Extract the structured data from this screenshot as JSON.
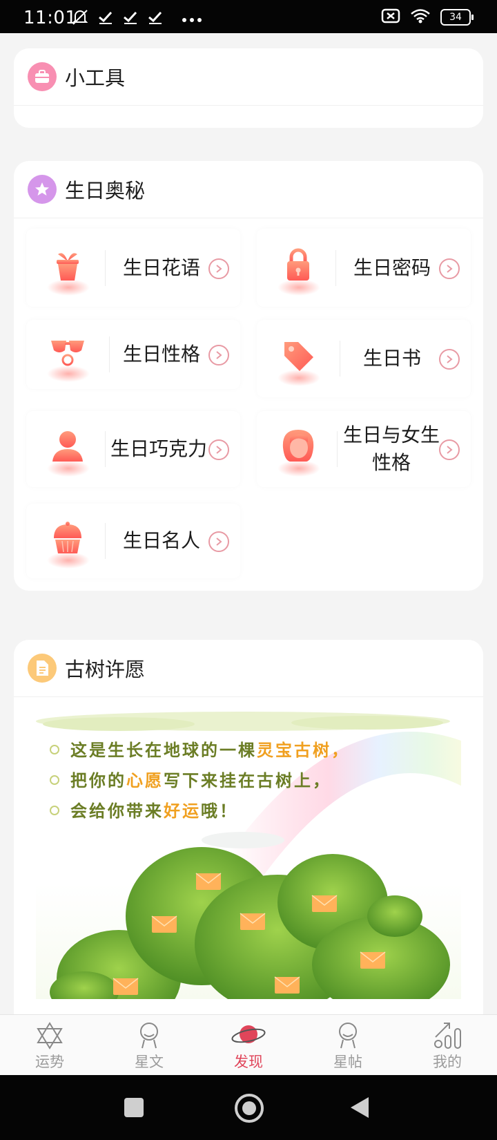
{
  "status_bar": {
    "time": "11:01",
    "battery": "34"
  },
  "tools_card": {
    "title": "小工具",
    "icon": "briefcase-icon"
  },
  "birthday_card": {
    "title": "生日奥秘",
    "icon": "star-icon",
    "items": [
      {
        "label": "生日花语",
        "icon": "flower-pot-icon"
      },
      {
        "label": "生日密码",
        "icon": "padlock-icon"
      },
      {
        "label": "生日性格",
        "icon": "glasses-icon"
      },
      {
        "label": "生日书",
        "icon": "tag-icon"
      },
      {
        "label": "生日巧克力",
        "icon": "person-icon"
      },
      {
        "label": "生日与女生性格",
        "icon": "girl-icon"
      },
      {
        "label": "生日名人",
        "icon": "cupcake-icon"
      }
    ]
  },
  "wish_card": {
    "title": "古树许愿",
    "icon": "document-icon",
    "lines": [
      {
        "pre": "这是生长在地球的一棵",
        "hl": "灵宝古树",
        "post": "，"
      },
      {
        "pre": "把你的",
        "hl": "心愿",
        "post": "写下来挂在古树上，"
      },
      {
        "pre": "会给你带来",
        "hl": "好运",
        "post": "哦！"
      }
    ]
  },
  "bottom_nav": {
    "items": [
      {
        "label": "运势",
        "icon": "hexagram-icon"
      },
      {
        "label": "星文",
        "icon": "astronaut-icon"
      },
      {
        "label": "发现",
        "icon": "planet-icon"
      },
      {
        "label": "星帖",
        "icon": "astronaut-icon"
      },
      {
        "label": "我的",
        "icon": "chart-arrow-icon"
      }
    ],
    "active_index": 2
  },
  "colors": {
    "accent": "#e0455a",
    "tile_icon": "#ff6a5c",
    "highlight": "#f0a020",
    "wish_text": "#6b7d25"
  }
}
